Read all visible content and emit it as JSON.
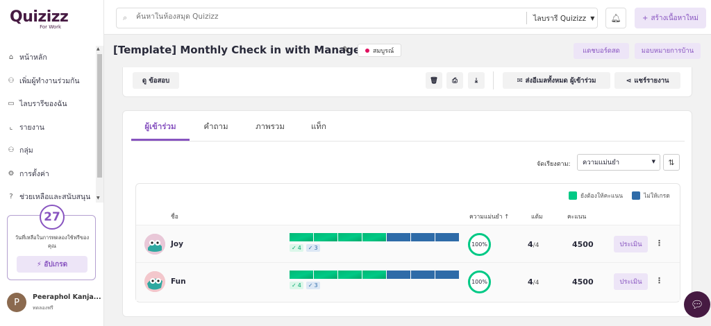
{
  "brand": {
    "logo": "Quizizz",
    "logo_sub": "For Work"
  },
  "sidebar": {
    "items": [
      {
        "label": "หน้าหลัก",
        "icon": "home-icon",
        "glyph": "⌂"
      },
      {
        "label": "เพิ่มผู้ทำงานร่วมกัน",
        "icon": "add-collaborator-icon",
        "glyph": "⚇"
      },
      {
        "label": "ไลบรารีของฉัน",
        "icon": "library-icon",
        "glyph": "▭"
      },
      {
        "label": "รายงาน",
        "icon": "report-icon",
        "glyph": "⌞"
      },
      {
        "label": "กลุ่ม",
        "icon": "group-icon",
        "glyph": "⚇"
      },
      {
        "label": "การตั้งค่า",
        "icon": "gear-icon",
        "glyph": "⚙"
      },
      {
        "label": "ช่วยเหลือและสนับสนุน",
        "icon": "help-icon",
        "glyph": "?"
      }
    ],
    "trial": {
      "days": "27",
      "text": "วันที่เหลือในการทดลองใช้ฟรีของคุณ",
      "upgrade_label": "อัปเกรด"
    },
    "user": {
      "initial": "P",
      "name": "Peeraphol Kanja...",
      "plan": "ทดลองฟรี"
    }
  },
  "topbar": {
    "search_placeholder": "ค้นหาในห้องสมุด Quizizz",
    "library_select": "ไลบรารี Quizizz",
    "create_label": "สร้างเนื้อหาใหม่"
  },
  "page": {
    "title": "[Template] Monthly Check in with Managers",
    "status": "สมบูรณ์",
    "dashboard_label": "แดชบอร์ดสด",
    "assign_label": "มอบหมายการบ้าน"
  },
  "actions": {
    "view_quiz": "ดู ข้อสอบ",
    "email_all": "ส่งอีเมลทั้งหมด ผู้เข้าร่วม",
    "share_report": "แชร์รายงาน"
  },
  "tabs": [
    "ผู้เข้าร่วม",
    "คำถาม",
    "ภาพรวม",
    "แท็ก"
  ],
  "sort": {
    "label": "จัดเรียงตาม:",
    "value": "ความแม่นยำ"
  },
  "legend": {
    "needs_grading": "ยังต้องให้คะแนน",
    "ungraded": "ไม่ให้เกรด"
  },
  "columns": {
    "name": "ชื่อ",
    "accuracy": "ความแม่นยำ ↑",
    "score": "แต้ม",
    "points": "คะแนน"
  },
  "colors": {
    "accent": "#8854c0",
    "green": "#00c985",
    "blue": "#2e6ba8",
    "brand": "#461a42"
  },
  "participants": [
    {
      "name": "Joy",
      "correct": "4",
      "incorrect": "3",
      "segments_green": 4,
      "segments_blue": 3,
      "accuracy": "100%",
      "score": "4",
      "score_total": "/4",
      "points": "4500",
      "evaluate_label": "ประเมิน",
      "avatar_bg": "#e8c6d6"
    },
    {
      "name": "Fun",
      "correct": "4",
      "incorrect": "3",
      "segments_green": 4,
      "segments_blue": 3,
      "accuracy": "100%",
      "score": "4",
      "score_total": "/4",
      "points": "4500",
      "evaluate_label": "ประเมิน",
      "avatar_bg": "#f2c4c9"
    }
  ]
}
